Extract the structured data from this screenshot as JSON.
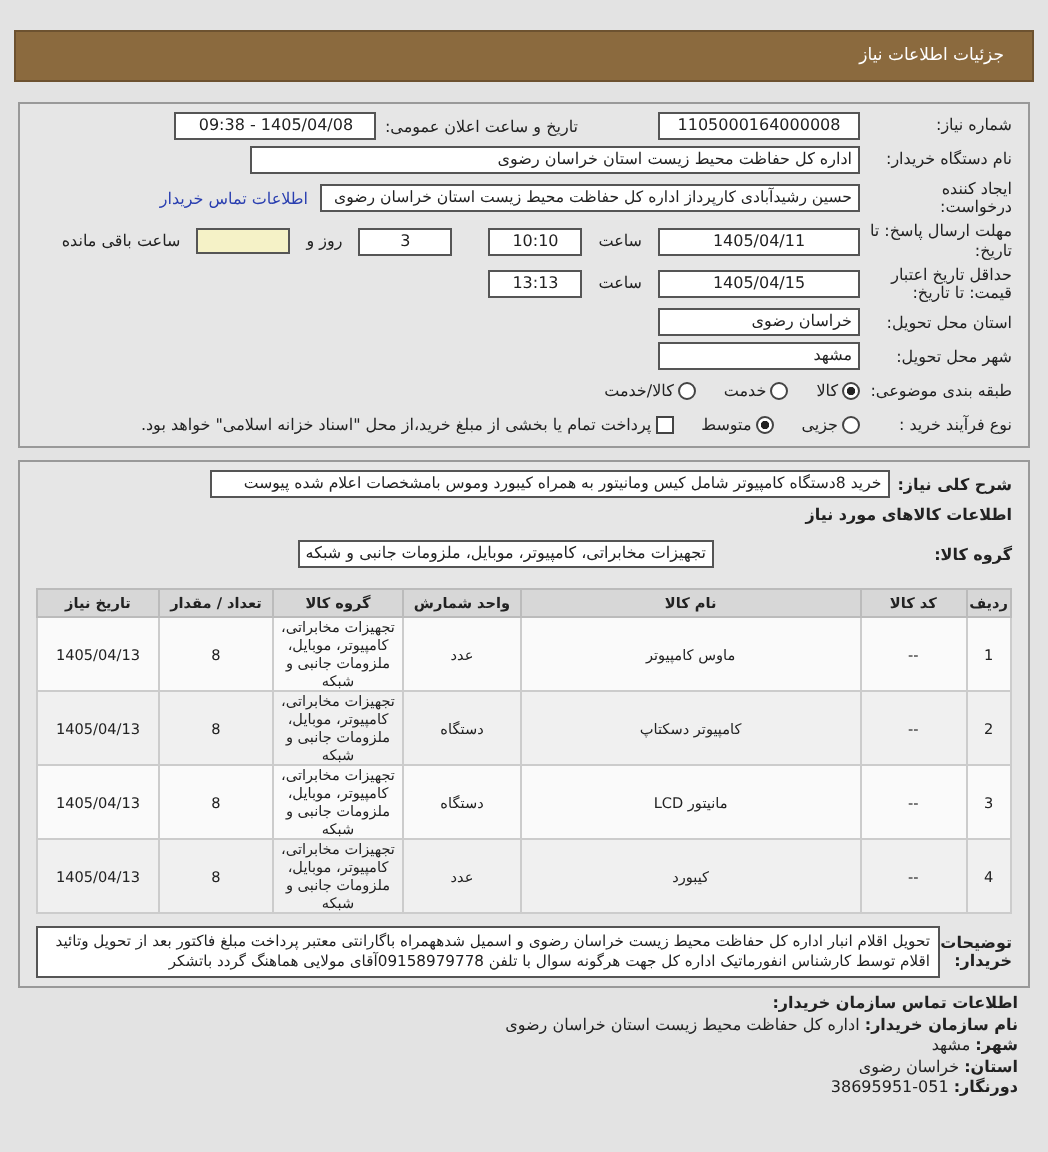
{
  "header": {
    "title": "جزئیات اطلاعات نیاز"
  },
  "need_number": {
    "label": "شماره نیاز:",
    "value": "1105000164000008"
  },
  "announce": {
    "label": "تاریخ و ساعت اعلان عمومی:",
    "value": "1405/04/08 - 09:38"
  },
  "buyer_org": {
    "label": "نام دستگاه خریدار:",
    "value": "اداره کل حفاظت محیط زیست استان خراسان رضوی"
  },
  "requester": {
    "label": "ایجاد کننده درخواست:",
    "value": "حسین رشیدآبادی کارپرداز اداره کل حفاظت محیط زیست استان خراسان رضوی",
    "link": "اطلاعات تماس خریدار"
  },
  "deadline": {
    "label": "مهلت ارسال پاسخ: تا تاریخ:",
    "date": "1405/04/11",
    "time_label": "ساعت",
    "time": "10:10",
    "days": "3",
    "days_label": "روز و",
    "remaining_label": "ساعت باقی مانده"
  },
  "validity": {
    "label": "حداقل تاریخ اعتبار قیمت: تا تاریخ:",
    "date": "1405/04/15",
    "time_label": "ساعت",
    "time": "13:13"
  },
  "province": {
    "label": "استان محل تحویل:",
    "value": "خراسان رضوی"
  },
  "city": {
    "label": "شهر محل تحویل:",
    "value": "مشهد"
  },
  "category": {
    "label": "طبقه بندی موضوعی:",
    "options": [
      {
        "label": "کالا",
        "selected": true
      },
      {
        "label": "خدمت",
        "selected": false
      },
      {
        "label": "کالا/خدمت",
        "selected": false
      }
    ]
  },
  "process": {
    "label": "نوع فرآیند خرید :",
    "options": [
      {
        "label": "جزیی",
        "selected": false
      },
      {
        "label": "متوسط",
        "selected": true
      }
    ],
    "checkbox": {
      "label": "پرداخت تمام یا بخشی از مبلغ خرید،از محل \"اسناد خزانه اسلامی\" خواهد بود.",
      "checked": false
    }
  },
  "summary": {
    "label": "شرح کلی نیاز:",
    "value": "خرید 8دستگاه کامپیوتر شامل کیس ومانیتور به همراه کیبورد وموس بامشخصات اعلام شده پیوست"
  },
  "goods_heading": "اطلاعات کالاهای مورد نیاز",
  "goods_group": {
    "label": "گروه کالا:",
    "value": "تجهیزات مخابراتی، کامپیوتر، موبایل، ملزومات جانبی و شبکه"
  },
  "table": {
    "columns": [
      "ردیف",
      "کد کالا",
      "نام کالا",
      "واحد شمارش",
      "گروه کالا",
      "تعداد / مقدار",
      "تاریخ نیاز"
    ],
    "rows": [
      [
        "1",
        "--",
        "ماوس کامپیوتر",
        "عدد",
        "تجهیزات مخابراتی، کامپیوتر، موبایل، ملزومات جانبی و شبکه",
        "8",
        "1405/04/13"
      ],
      [
        "2",
        "--",
        "کامپیوتر دسکتاپ",
        "دستگاه",
        "تجهیزات مخابراتی، کامپیوتر، موبایل، ملزومات جانبی و شبکه",
        "8",
        "1405/04/13"
      ],
      [
        "3",
        "--",
        "مانیتور LCD",
        "دستگاه",
        "تجهیزات مخابراتی، کامپیوتر، موبایل، ملزومات جانبی و شبکه",
        "8",
        "1405/04/13"
      ],
      [
        "4",
        "--",
        "کیبورد",
        "عدد",
        "تجهیزات مخابراتی، کامپیوتر، موبایل، ملزومات جانبی و شبکه",
        "8",
        "1405/04/13"
      ]
    ]
  },
  "buyer_notes": {
    "label": "توضیحات خریدار:",
    "value": "تحویل اقلام انبار اداره کل حفاظت محیط زیست خراسان رضوی و اسمیل شدههمراه باگارانتی معتبر پرداخت مبلغ فاکتور بعد از تحویل وتائید اقلام توسط کارشناس انفورماتیک اداره کل جهت هرگونه سوال با تلفن 09158979778آقای مولایی هماهنگ گردد باتشکر"
  },
  "contact": {
    "heading": "اطلاعات تماس سازمان خریدار:",
    "lines": [
      {
        "label": "نام سازمان خریدار:",
        "value": "اداره کل حفاظت محیط زیست استان خراسان رضوی"
      },
      {
        "label": "شهر:",
        "value": "مشهد"
      },
      {
        "label": "استان:",
        "value": "خراسان رضوی"
      },
      {
        "label": "دورنگار:",
        "value": "051-38695951"
      }
    ]
  }
}
